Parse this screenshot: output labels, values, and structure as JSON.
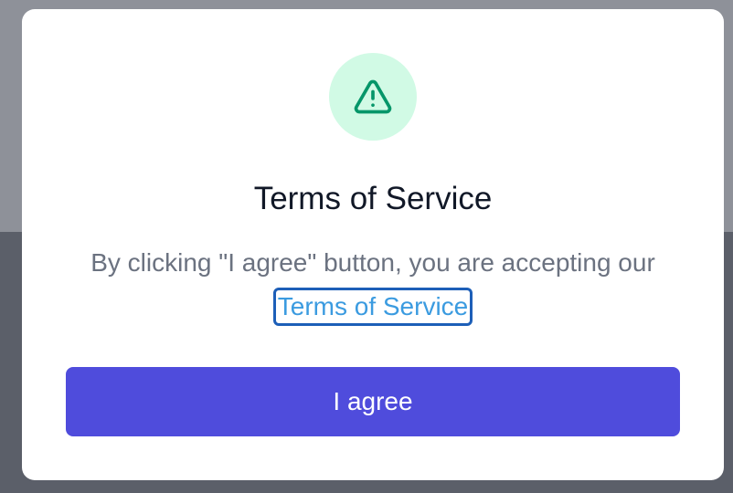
{
  "dialog": {
    "title": "Terms of Service",
    "message": "By clicking \"I agree\" button, you are accepting our",
    "link_text": "Terms of Service",
    "agree_label": "I agree",
    "icon": "warning-triangle-icon"
  },
  "colors": {
    "icon_bg": "#d1fae5",
    "icon_stroke": "#059669",
    "button_bg": "#4f4cdc",
    "link": "#3b9be0",
    "focus_ring": "#1d5fb8"
  }
}
